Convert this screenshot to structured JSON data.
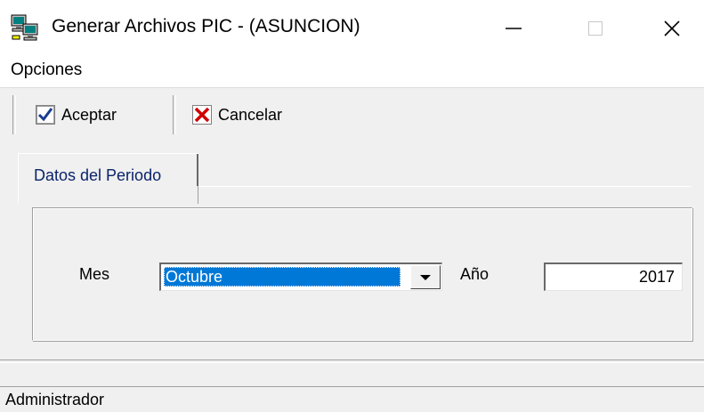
{
  "window": {
    "title": "Generar Archivos PIC - (ASUNCION)"
  },
  "menu": {
    "items": [
      "Opciones"
    ]
  },
  "toolbar": {
    "accept_label": "Aceptar",
    "cancel_label": "Cancelar",
    "accept_icon": "checkmark-icon",
    "cancel_icon": "red-x-icon"
  },
  "tabs": [
    {
      "label": "Datos del Periodo",
      "active": true
    }
  ],
  "form": {
    "month_label": "Mes",
    "month_value": "Octubre",
    "year_label": "Año",
    "year_value": "2017"
  },
  "status": {
    "user": "Administrador"
  },
  "colors": {
    "selection": "#0078d7",
    "tab_text": "#0a246a",
    "cancel_x": "#d00000",
    "check": "#1a3d8f"
  }
}
